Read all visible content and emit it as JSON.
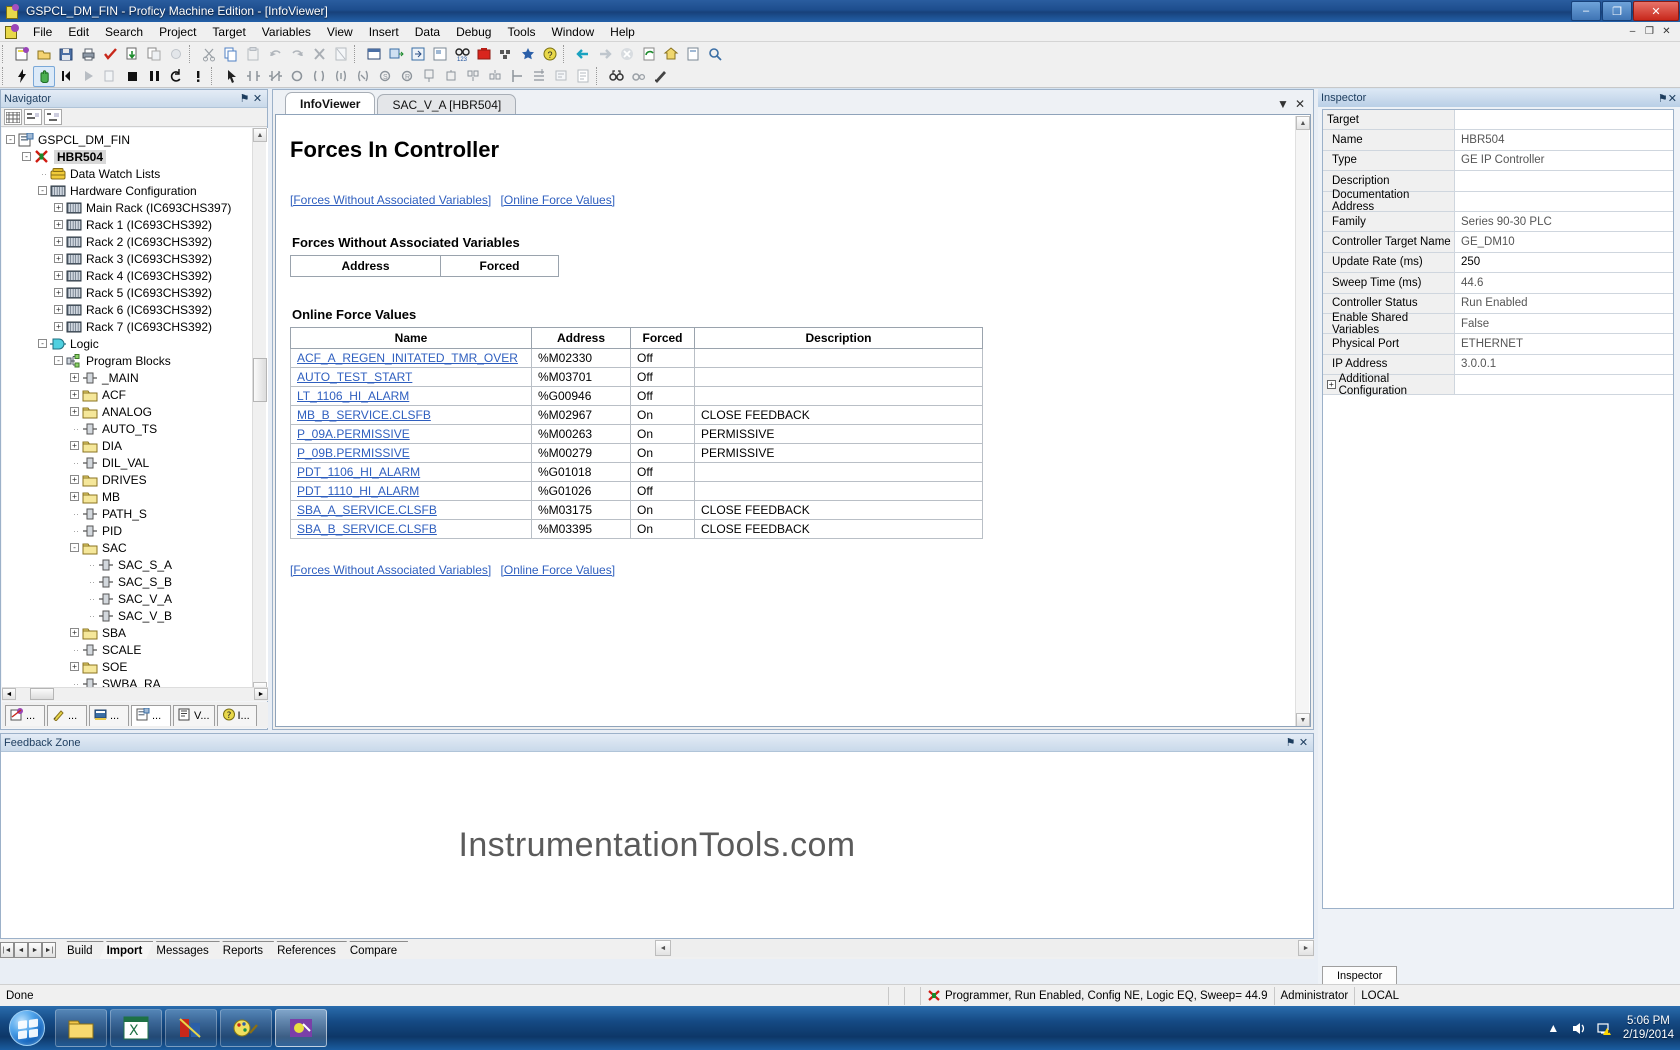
{
  "window": {
    "title": "GSPCL_DM_FIN - Proficy Machine Edition - [InfoViewer]",
    "minimize": "–",
    "maximize": "❐",
    "close": "✕",
    "inner_minimize": "–",
    "inner_restore": "❐",
    "inner_close": "✕"
  },
  "menu": {
    "items": [
      "File",
      "Edit",
      "Search",
      "Project",
      "Target",
      "Variables",
      "View",
      "Insert",
      "Data",
      "Debug",
      "Tools",
      "Window",
      "Help"
    ]
  },
  "navigator": {
    "title": "Navigator",
    "pin": "⚑",
    "close": "✕",
    "tree": [
      {
        "depth": 0,
        "expander": "-",
        "label": "GSPCL_DM_FIN",
        "icon": "project-icon",
        "selected": false
      },
      {
        "depth": 1,
        "expander": "-",
        "label": "HBR504",
        "icon": "target-error-icon",
        "selected": true
      },
      {
        "depth": 2,
        "expander": "",
        "label": "Data Watch Lists",
        "icon": "watchlist-icon",
        "selected": false
      },
      {
        "depth": 2,
        "expander": "-",
        "label": "Hardware Configuration",
        "icon": "rack-icon",
        "selected": false
      },
      {
        "depth": 3,
        "expander": "+",
        "label": "Main Rack (IC693CHS397)",
        "icon": "rack-icon",
        "selected": false
      },
      {
        "depth": 3,
        "expander": "+",
        "label": "Rack 1 (IC693CHS392)",
        "icon": "rack-icon",
        "selected": false
      },
      {
        "depth": 3,
        "expander": "+",
        "label": "Rack 2 (IC693CHS392)",
        "icon": "rack-icon",
        "selected": false
      },
      {
        "depth": 3,
        "expander": "+",
        "label": "Rack 3 (IC693CHS392)",
        "icon": "rack-icon",
        "selected": false
      },
      {
        "depth": 3,
        "expander": "+",
        "label": "Rack 4 (IC693CHS392)",
        "icon": "rack-icon",
        "selected": false
      },
      {
        "depth": 3,
        "expander": "+",
        "label": "Rack 5 (IC693CHS392)",
        "icon": "rack-icon",
        "selected": false
      },
      {
        "depth": 3,
        "expander": "+",
        "label": "Rack 6 (IC693CHS392)",
        "icon": "rack-icon",
        "selected": false
      },
      {
        "depth": 3,
        "expander": "+",
        "label": "Rack 7 (IC693CHS392)",
        "icon": "rack-icon",
        "selected": false
      },
      {
        "depth": 2,
        "expander": "-",
        "label": "Logic",
        "icon": "logic-icon",
        "selected": false
      },
      {
        "depth": 3,
        "expander": "-",
        "label": "Program Blocks",
        "icon": "programblocks-icon",
        "selected": false
      },
      {
        "depth": 4,
        "expander": "+",
        "label": "_MAIN",
        "icon": "block-icon",
        "selected": false
      },
      {
        "depth": 4,
        "expander": "+",
        "label": "ACF",
        "icon": "folder-icon",
        "selected": false
      },
      {
        "depth": 4,
        "expander": "+",
        "label": "ANALOG",
        "icon": "folder-icon",
        "selected": false
      },
      {
        "depth": 4,
        "expander": "",
        "label": "AUTO_TS",
        "icon": "block-icon",
        "selected": false
      },
      {
        "depth": 4,
        "expander": "+",
        "label": "DIA",
        "icon": "folder-icon",
        "selected": false
      },
      {
        "depth": 4,
        "expander": "",
        "label": "DIL_VAL",
        "icon": "block-icon",
        "selected": false
      },
      {
        "depth": 4,
        "expander": "+",
        "label": "DRIVES",
        "icon": "folder-icon",
        "selected": false
      },
      {
        "depth": 4,
        "expander": "+",
        "label": "MB",
        "icon": "folder-icon",
        "selected": false
      },
      {
        "depth": 4,
        "expander": "",
        "label": "PATH_S",
        "icon": "block-icon",
        "selected": false
      },
      {
        "depth": 4,
        "expander": "",
        "label": "PID",
        "icon": "block-icon",
        "selected": false
      },
      {
        "depth": 4,
        "expander": "-",
        "label": "SAC",
        "icon": "folder-icon",
        "selected": false
      },
      {
        "depth": 5,
        "expander": "",
        "label": "SAC_S_A",
        "icon": "block-icon",
        "selected": false
      },
      {
        "depth": 5,
        "expander": "",
        "label": "SAC_S_B",
        "icon": "block-icon",
        "selected": false
      },
      {
        "depth": 5,
        "expander": "",
        "label": "SAC_V_A",
        "icon": "block-icon",
        "selected": false
      },
      {
        "depth": 5,
        "expander": "",
        "label": "SAC_V_B",
        "icon": "block-icon",
        "selected": false
      },
      {
        "depth": 4,
        "expander": "+",
        "label": "SBA",
        "icon": "folder-icon",
        "selected": false
      },
      {
        "depth": 4,
        "expander": "",
        "label": "SCALE",
        "icon": "block-icon",
        "selected": false
      },
      {
        "depth": 4,
        "expander": "+",
        "label": "SOE",
        "icon": "folder-icon",
        "selected": false
      },
      {
        "depth": 4,
        "expander": "",
        "label": "SWBA_RA",
        "icon": "block-icon",
        "selected": false
      }
    ],
    "tabs": [
      {
        "label": "...",
        "icon": "navigator-tab-icon",
        "active": false
      },
      {
        "label": "...",
        "icon": "manager-tab-icon",
        "active": false
      },
      {
        "label": "...",
        "icon": "inspector-tab-icon",
        "active": false
      },
      {
        "label": "...",
        "icon": "feedback-tab-icon",
        "active": true
      },
      {
        "label": "V...",
        "icon": "variables-tab-icon",
        "active": false
      },
      {
        "label": "I...",
        "icon": "help-tab-icon",
        "active": false
      }
    ]
  },
  "document": {
    "tabs": [
      {
        "label": "InfoViewer",
        "active": true
      },
      {
        "label": "SAC_V_A [HBR504]",
        "active": false
      }
    ],
    "tab_buttons": {
      "dropdown": "▼",
      "close": "✕"
    }
  },
  "infoviewer": {
    "title": "Forces In Controller",
    "links": [
      {
        "label": "[Forces Without Associated Variables]"
      },
      {
        "label": "[Online Force Values]"
      }
    ],
    "section1": {
      "heading": "Forces Without Associated Variables",
      "columns": [
        "Address",
        "Forced"
      ],
      "rows": []
    },
    "section2": {
      "heading": "Online Force Values",
      "columns": [
        "Name",
        "Address",
        "Forced",
        "Description"
      ],
      "rows": [
        {
          "name": "ACF_A_REGEN_INITATED_TMR_OVER",
          "address": "%M02330",
          "forced": "Off",
          "description": ""
        },
        {
          "name": "AUTO_TEST_START",
          "address": "%M03701",
          "forced": "Off",
          "description": ""
        },
        {
          "name": "LT_1106_HI_ALARM",
          "address": "%G00946",
          "forced": "Off",
          "description": ""
        },
        {
          "name": "MB_B_SERVICE.CLSFB",
          "address": "%M02967",
          "forced": "On",
          "description": "CLOSE FEEDBACK"
        },
        {
          "name": "P_09A.PERMISSIVE",
          "address": "%M00263",
          "forced": "On",
          "description": "PERMISSIVE"
        },
        {
          "name": "P_09B.PERMISSIVE",
          "address": "%M00279",
          "forced": "On",
          "description": "PERMISSIVE"
        },
        {
          "name": "PDT_1106_HI_ALARM",
          "address": "%G01018",
          "forced": "Off",
          "description": ""
        },
        {
          "name": "PDT_1110_HI_ALARM",
          "address": "%G01026",
          "forced": "Off",
          "description": ""
        },
        {
          "name": "SBA_A_SERVICE.CLSFB",
          "address": "%M03175",
          "forced": "On",
          "description": "CLOSE FEEDBACK"
        },
        {
          "name": "SBA_B_SERVICE.CLSFB",
          "address": "%M03395",
          "forced": "On",
          "description": "CLOSE FEEDBACK"
        }
      ]
    },
    "footer_links": [
      {
        "label": "[Forces Without Associated Variables]"
      },
      {
        "label": "[Online Force Values]"
      }
    ]
  },
  "feedback": {
    "title": "Feedback Zone",
    "pin": "⚑",
    "close": "✕",
    "watermark": "InstrumentationTools.com",
    "tabs": [
      {
        "label": "Build",
        "active": false
      },
      {
        "label": "Import",
        "active": true
      },
      {
        "label": "Messages",
        "active": false
      },
      {
        "label": "Reports",
        "active": false
      },
      {
        "label": "References",
        "active": false
      },
      {
        "label": "Compare",
        "active": false
      }
    ]
  },
  "inspector": {
    "title": "Inspector",
    "pin": "⚑",
    "close": "✕",
    "bottom_tab": "Inspector",
    "rows": [
      {
        "label": "Target",
        "value": "",
        "group": true
      },
      {
        "label": "Name",
        "value": "HBR504"
      },
      {
        "label": "Type",
        "value": "GE IP Controller"
      },
      {
        "label": "Description",
        "value": ""
      },
      {
        "label": "Documentation Address",
        "value": ""
      },
      {
        "label": "Family",
        "value": "Series 90-30 PLC"
      },
      {
        "label": "Controller Target Name",
        "value": "GE_DM10"
      },
      {
        "label": "Update Rate (ms)",
        "value": "250",
        "strong": true
      },
      {
        "label": "Sweep Time (ms)",
        "value": "44.6"
      },
      {
        "label": "Controller Status",
        "value": "Run Enabled"
      },
      {
        "label": "Enable Shared Variables",
        "value": "False"
      },
      {
        "label": "Physical Port",
        "value": "ETHERNET"
      },
      {
        "label": "IP Address",
        "value": "3.0.0.1"
      },
      {
        "label": "Additional Configuration",
        "value": "",
        "expandable": true
      }
    ]
  },
  "statusbar": {
    "left": "Done",
    "controller_status": "Programmer, Run Enabled, Config NE, Logic EQ, Sweep= 44.9",
    "user": "Administrator",
    "scope": "LOCAL"
  },
  "taskbar": {
    "start_label": "Start",
    "buttons": [
      {
        "name": "explorer",
        "active": false
      },
      {
        "name": "excel",
        "active": false
      },
      {
        "name": "proficy",
        "active": false
      },
      {
        "name": "paint",
        "active": false
      },
      {
        "name": "app5",
        "active": true
      }
    ],
    "tray": {
      "show_hidden": "▲",
      "volume": "volume-icon",
      "network": "network-icon"
    },
    "clock_time": "5:06 PM",
    "clock_date": "2/19/2014"
  }
}
